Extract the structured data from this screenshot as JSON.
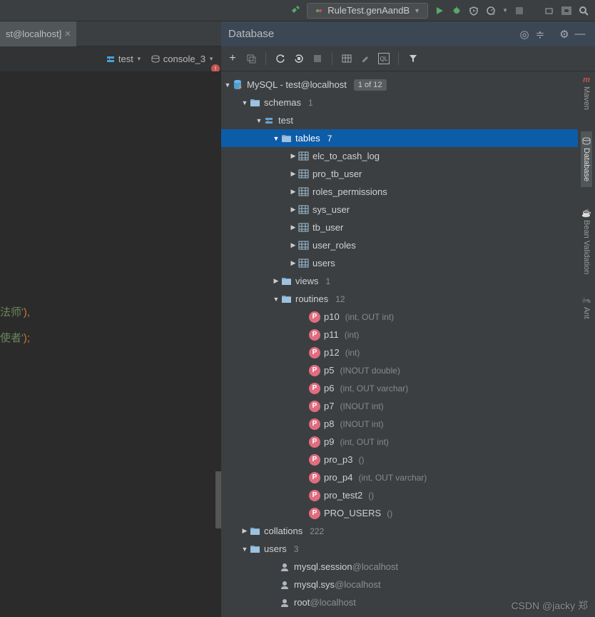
{
  "toolbar": {
    "run_config": "RuleTest.genAandB"
  },
  "editor_tab": {
    "title": "st@localhost]"
  },
  "editor_dd": {
    "target": "test",
    "session": "console_3"
  },
  "panel": {
    "title": "Database"
  },
  "tree": {
    "root": "MySQL - test@localhost",
    "root_badge": "1 of 12",
    "schemas": {
      "label": "schemas",
      "count": "1"
    },
    "db": "test",
    "tables": {
      "label": "tables",
      "count": "7",
      "items": [
        "elc_to_cash_log",
        "pro_tb_user",
        "roles_permissions",
        "sys_user",
        "tb_user",
        "user_roles",
        "users"
      ]
    },
    "views": {
      "label": "views",
      "count": "1"
    },
    "routines": {
      "label": "routines",
      "count": "12",
      "items": [
        {
          "name": "p10",
          "sig": "(int, OUT int)"
        },
        {
          "name": "p11",
          "sig": "(int)"
        },
        {
          "name": "p12",
          "sig": "(int)"
        },
        {
          "name": "p5",
          "sig": "(INOUT double)"
        },
        {
          "name": "p6",
          "sig": "(int, OUT varchar)"
        },
        {
          "name": "p7",
          "sig": "(INOUT int)"
        },
        {
          "name": "p8",
          "sig": "(INOUT int)"
        },
        {
          "name": "p9",
          "sig": "(int, OUT int)"
        },
        {
          "name": "pro_p3",
          "sig": "()"
        },
        {
          "name": "pro_p4",
          "sig": "(int, OUT varchar)"
        },
        {
          "name": "pro_test2",
          "sig": "()"
        },
        {
          "name": "PRO_USERS",
          "sig": "()"
        }
      ]
    },
    "collations": {
      "label": "collations",
      "count": "222"
    },
    "users": {
      "label": "users",
      "count": "3",
      "items": [
        {
          "name": "mysql.session",
          "host": "@localhost"
        },
        {
          "name": "mysql.sys",
          "host": "@localhost"
        },
        {
          "name": "root",
          "host": "@localhost"
        }
      ]
    }
  },
  "code": {
    "l1a": "法师'",
    "l1b": "),",
    "l2a": "使者'",
    "l2b": ");"
  },
  "sidebar": {
    "maven": "Maven",
    "db": "Database",
    "bean": "Bean Validation",
    "ant": "Ant"
  },
  "watermark": "CSDN @jacky 郑"
}
